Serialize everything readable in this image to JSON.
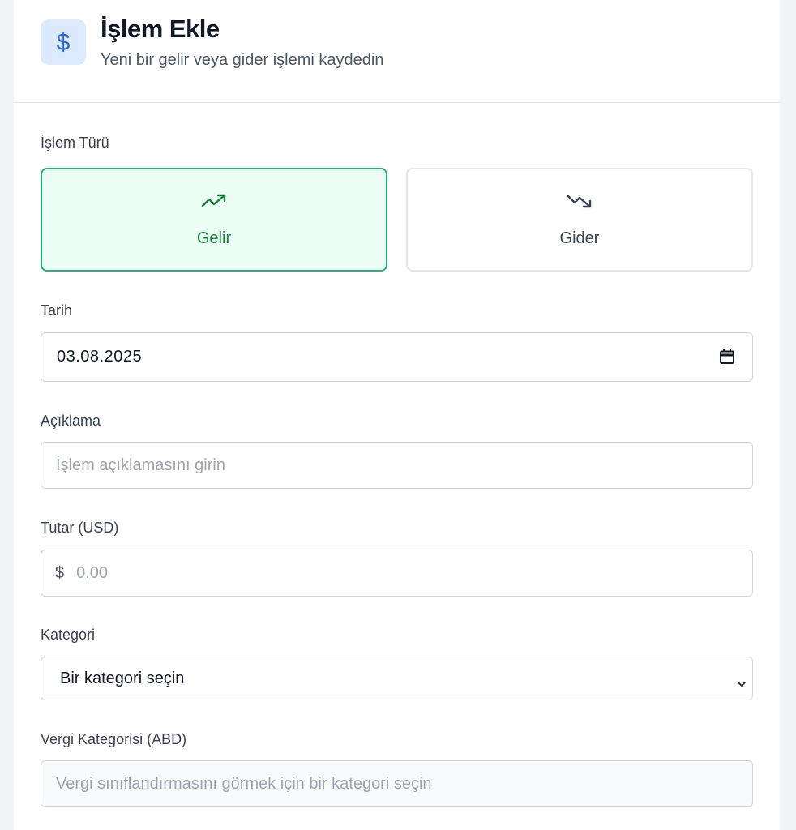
{
  "header": {
    "icon": "dollar-icon",
    "title": "İşlem Ekle",
    "subtitle": "Yeni bir gelir veya gider işlemi kaydedin"
  },
  "transaction_type": {
    "label": "İşlem Türü",
    "options": [
      {
        "label": "Gelir",
        "icon": "trending-up-icon",
        "selected": true,
        "color": "#15803d"
      },
      {
        "label": "Gider",
        "icon": "trending-down-icon",
        "selected": false
      }
    ]
  },
  "date": {
    "label": "Tarih",
    "value": "03.08.2025",
    "icon": "calendar-icon"
  },
  "description": {
    "label": "Açıklama",
    "placeholder": "İşlem açıklamasını girin"
  },
  "amount": {
    "label": "Tutar (USD)",
    "prefix": "$",
    "placeholder": "0.00"
  },
  "category": {
    "label": "Kategori",
    "selected": "Bir kategori seçin",
    "icon": "chevron-down-icon"
  },
  "tax_category": {
    "label": "Vergi Kategorisi (ABD)",
    "placeholder": "Vergi sınıflandırmasını görmek için bir kategori seçin"
  },
  "colors": {
    "accent_income": "#22b37e",
    "income_bg": "#ecfdf3",
    "icon_bg": "#dbeafe",
    "icon_fg": "#2563eb"
  }
}
